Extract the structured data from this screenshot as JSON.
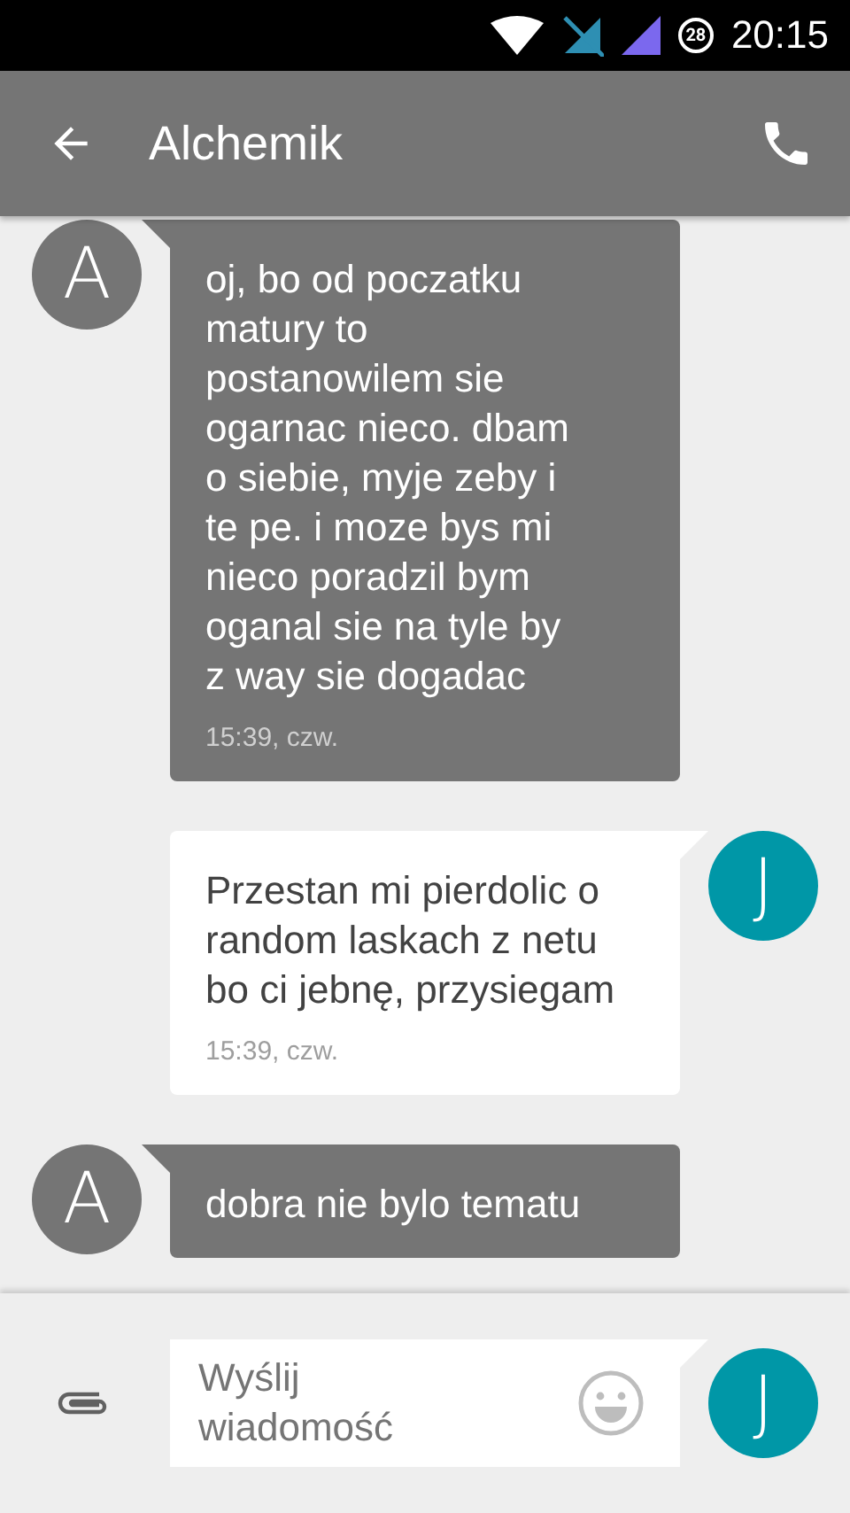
{
  "status_bar": {
    "battery": "28",
    "time": "20:15"
  },
  "app_bar": {
    "title": "Alchemik"
  },
  "messages": [
    {
      "kind": "incoming",
      "avatar": "A",
      "text": "oj, bo od poczatku matury to postanowilem sie ogarnac nieco. dbam o siebie, myje zeby i te pe. i moze bys mi nieco poradzil bym oganal sie na tyle by z way sie dogadac",
      "time": "15:39, czw."
    },
    {
      "kind": "outgoing",
      "avatar": "J",
      "text": "Przestan mi pierdolic o random laskach z netu bo ci jebnę, przysiegam",
      "time": "15:39, czw."
    },
    {
      "kind": "incoming",
      "avatar": "A",
      "text": "dobra nie bylo tematu"
    }
  ],
  "composer": {
    "placeholder": "Wyślij wiadomość",
    "avatar": "J"
  }
}
